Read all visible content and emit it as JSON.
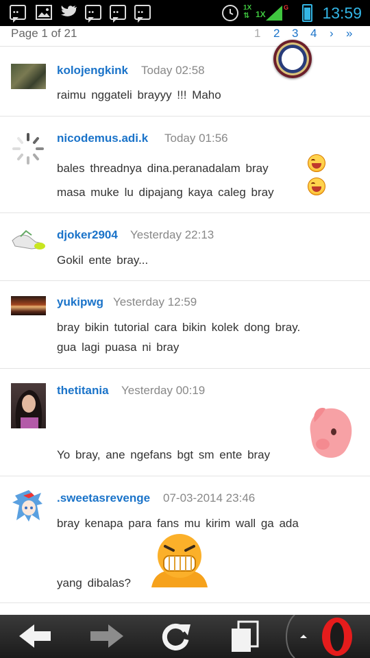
{
  "status_bar": {
    "time": "13:59",
    "network_top": "1X",
    "network_mid": "1X",
    "signal_badge": "G",
    "colors": {
      "time": "#33b5e5",
      "background": "#000000"
    },
    "icons": [
      "bbm-icon",
      "image-icon",
      "twitter-icon",
      "bbm-icon",
      "bbm-icon",
      "bbm-icon",
      "alarm-icon",
      "signal-icon",
      "battery-icon"
    ]
  },
  "pagination": {
    "label": "Page 1 of 21",
    "pages": [
      "1",
      "2",
      "3",
      "4"
    ],
    "next": "›",
    "last": "»"
  },
  "posts": [
    {
      "username": "kolojengkink",
      "time": "Today  02:58",
      "lines": [
        "raimu nggateli  brayyy  !!!  Maho"
      ]
    },
    {
      "username": "nicodemus.adi.k",
      "time": "Today  01:56",
      "lines": [
        "bales threadnya  dina.peranadalam  bray",
        "masa muke lu dipajang kaya caleg bray"
      ]
    },
    {
      "username": "djoker2904",
      "time": "Yesterday  22:13",
      "lines": [
        "Gokil ente bray..."
      ]
    },
    {
      "username": "yukipwg",
      "time": "Yesterday  12:59",
      "lines": [
        "bray bikin tutorial cara bikin kolek dong bray.",
        "gua lagi puasa ni bray"
      ]
    },
    {
      "username": "thetitania",
      "time": "Yesterday  00:19",
      "lines": [
        "Yo bray, ane ngefans bgt sm ente bray"
      ]
    },
    {
      "username": ".sweetasrevenge",
      "time": "07-03-2014  23:46",
      "lines": [
        "bray kenapa para fans mu kirim wall ga ada",
        "yang dibalas?"
      ]
    }
  ],
  "browser_bar": {
    "buttons": [
      "back-arrow-icon",
      "forward-arrow-icon",
      "reload-icon",
      "tabs-icon",
      "opera-menu-icon"
    ]
  },
  "colors": {
    "link": "#1a73c9",
    "muted": "#888888",
    "text": "#333333"
  }
}
